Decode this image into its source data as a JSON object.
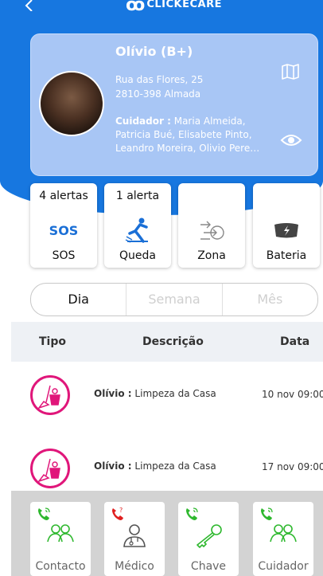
{
  "header": {
    "back_icon": "chevron-left-icon",
    "logo_text": "CLICKECARE"
  },
  "profile": {
    "name": "Olívio (B+)",
    "address_line1": "Rua das Flores, 25",
    "address_line2": "2810-398 Almada",
    "caregiver_label": "Cuidador :",
    "caregivers": "Maria Almeida, Patricia Bué, Elisabete Pinto, Leandro Moreira, Olivio Pere…",
    "map_icon": "map-icon",
    "eye_icon": "eye-icon"
  },
  "stats": [
    {
      "count": "4 alertas",
      "icon_text": "SOS",
      "label": "SOS"
    },
    {
      "count": "1 alerta",
      "icon": "fall-icon",
      "label": "Queda"
    },
    {
      "count": "",
      "icon": "zone-icon",
      "label": "Zona"
    },
    {
      "count": "",
      "icon": "battery-icon",
      "label": "Bateria"
    }
  ],
  "period_tabs": [
    "Dia",
    "Semana",
    "Mês"
  ],
  "table": {
    "headers": {
      "type": "Tipo",
      "description": "Descrição",
      "date": "Data"
    },
    "rows": [
      {
        "icon": "house-cleaning-icon",
        "who": "Olívio :",
        "what": "Limpeza da Casa",
        "date": "10 nov 09:00"
      },
      {
        "icon": "house-cleaning-icon",
        "who": "Olívio :",
        "what": "Limpeza da Casa",
        "date": "17 nov 09:00"
      }
    ]
  },
  "contacts": [
    {
      "label": "Contacto",
      "phone_color": "#2eb82e",
      "icon": "people-icon"
    },
    {
      "label": "Médico",
      "phone_color": "#e02020",
      "icon": "doctor-icon"
    },
    {
      "label": "Chave",
      "phone_color": "#2eb82e",
      "icon": "key-icon"
    },
    {
      "label": "Cuidador",
      "phone_color": "#2eb82e",
      "icon": "people-icon"
    }
  ],
  "colors": {
    "primary": "#1777e0",
    "card": "#a8c6f5",
    "magenta": "#e0167a",
    "green": "#2eb82e",
    "red": "#e02020"
  }
}
